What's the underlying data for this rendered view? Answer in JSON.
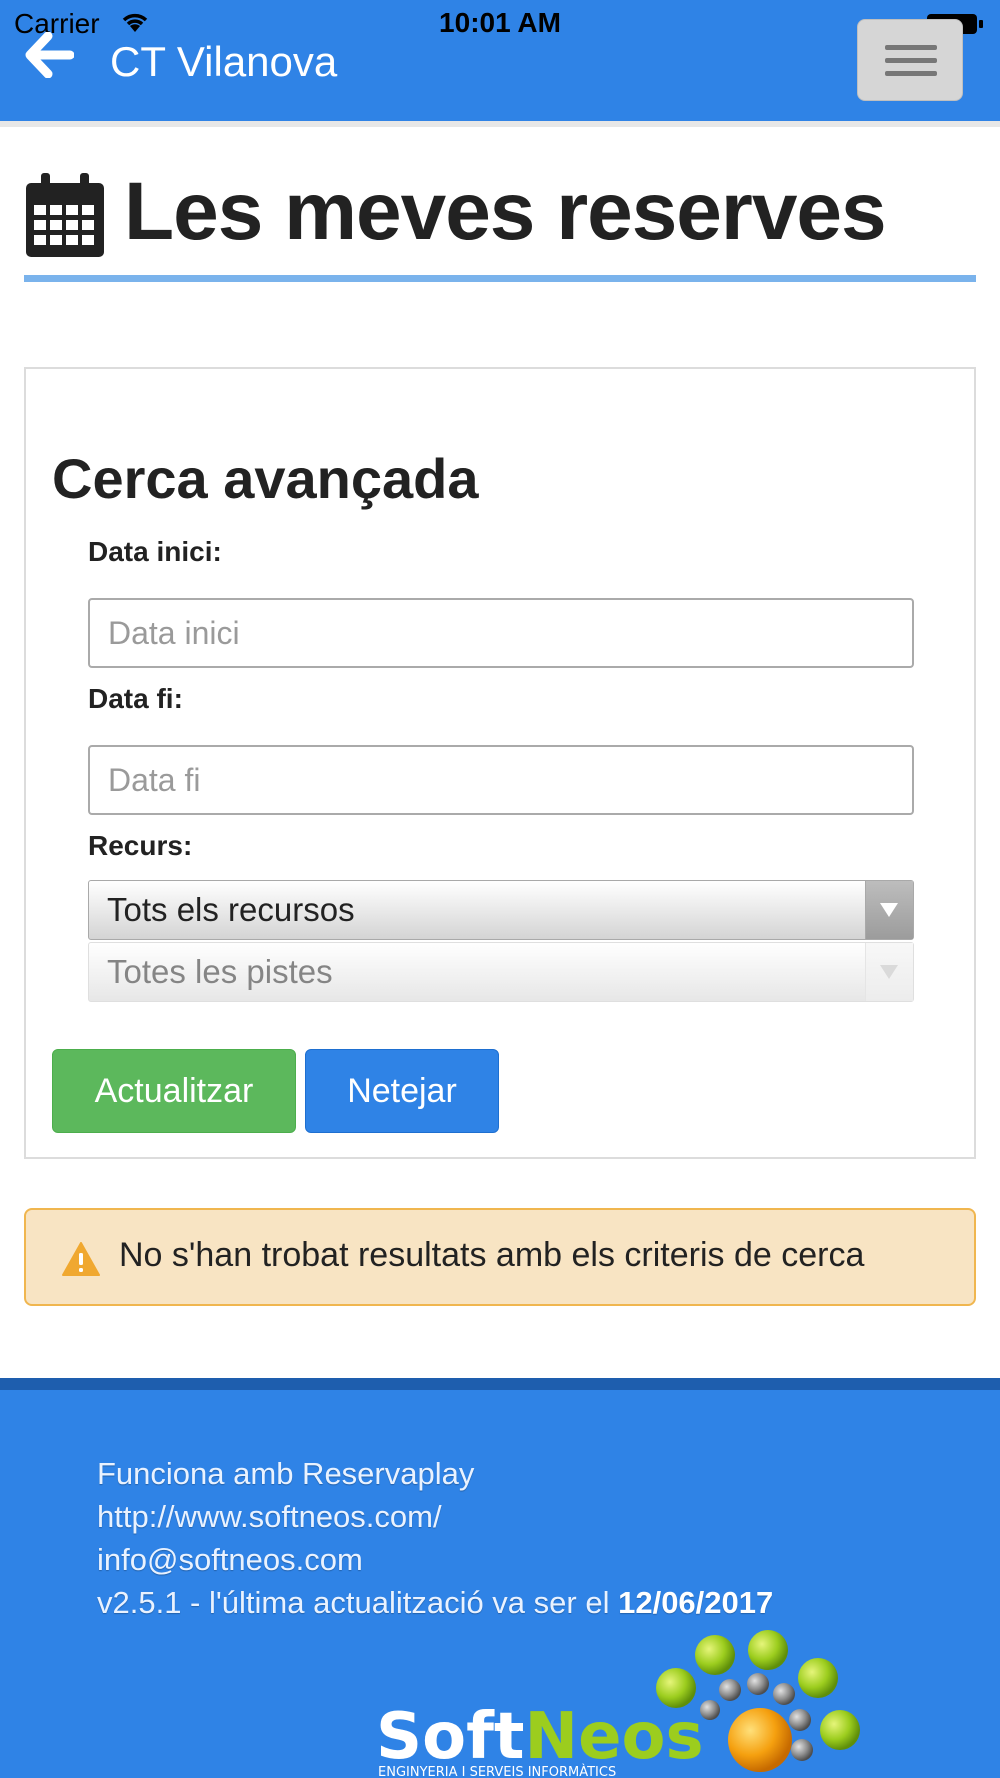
{
  "status_bar": {
    "carrier": "Carrier",
    "time": "10:01 AM"
  },
  "header": {
    "title": "CT Vilanova",
    "back_icon": "back-arrow-icon",
    "menu_icon": "hamburger-menu-icon",
    "color": "#2f83e6"
  },
  "page": {
    "title": "Les meves reserves",
    "icon": "calendar-icon"
  },
  "search": {
    "title": "Cerca avançada",
    "start_date": {
      "label": "Data inici:",
      "placeholder": "Data inici",
      "value": ""
    },
    "end_date": {
      "label": "Data fi:",
      "placeholder": "Data fi",
      "value": ""
    },
    "resource": {
      "label": "Recurs:",
      "selected": "Tots els recursos",
      "sub_selected": "Totes les pistes"
    },
    "update_button": "Actualitzar",
    "clear_button": "Netejar"
  },
  "alert": {
    "icon": "warning-icon",
    "text": "No s'han trobat resultats amb els criteris de cerca"
  },
  "footer": {
    "powered_by": "Funciona amb Reservaplay",
    "url": "http://www.softneos.com/",
    "email": "info@softneos.com",
    "version_prefix": "v2.5.1 - l'última actualització va ser el ",
    "version_date": "12/06/2017",
    "logo_text": "SoftNeos",
    "logo_tagline": "ENGINYERIA I SERVEIS INFORMÀTICS"
  },
  "colors": {
    "primary": "#2f83e6",
    "success": "#5cb85c",
    "warning_bg": "#f8e4c3",
    "warning_border": "#f0b64f"
  }
}
